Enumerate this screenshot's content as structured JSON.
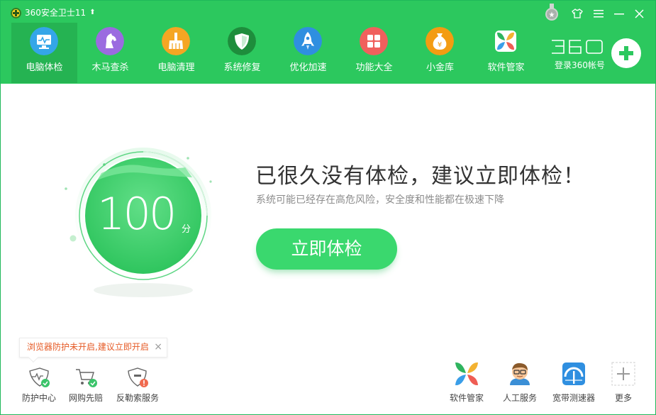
{
  "app": {
    "title": "360安全卫士11"
  },
  "tabs": [
    {
      "label": "电脑体检",
      "icon": "monitor-check-icon",
      "color": "#34a6e8"
    },
    {
      "label": "木马查杀",
      "icon": "horse-icon",
      "color": "#9b6be0"
    },
    {
      "label": "电脑清理",
      "icon": "broom-icon",
      "color": "#f5a623"
    },
    {
      "label": "系统修复",
      "icon": "shield-icon",
      "color": "#1e8d3c"
    },
    {
      "label": "优化加速",
      "icon": "rocket-icon",
      "color": "#2f8fe0"
    },
    {
      "label": "功能大全",
      "icon": "grid-icon",
      "color": "#f0605d"
    },
    {
      "label": "小金库",
      "icon": "money-bag-icon",
      "color": "#f39c12"
    },
    {
      "label": "软件管家",
      "icon": "software-manager-icon",
      "color": "#ffffff"
    }
  ],
  "login": {
    "brand": "360",
    "label": "登录360帐号"
  },
  "score": {
    "value": "100",
    "unit": "分"
  },
  "main": {
    "headline": "已很久没有体检，建议立即体检！",
    "subtitle": "系统可能已经存在高危风险，安全度和性能都在极速下降",
    "button": "立即体检"
  },
  "tooltip": {
    "text": "浏览器防护未开启,建议立即开启"
  },
  "bottom_left": [
    {
      "label": "防护中心",
      "icon": "protection-center-icon"
    },
    {
      "label": "网购先赔",
      "icon": "shopping-cart-icon"
    },
    {
      "label": "反勒索服务",
      "icon": "anti-ransom-icon"
    }
  ],
  "bottom_right": [
    {
      "label": "软件管家",
      "icon": "software-manager-icon"
    },
    {
      "label": "人工服务",
      "icon": "customer-service-icon"
    },
    {
      "label": "宽带测速器",
      "icon": "speed-test-icon"
    },
    {
      "label": "更多",
      "icon": "more-icon"
    }
  ],
  "colors": {
    "brand_green": "#2cc85e",
    "button_green": "#3ad86e",
    "warning": "#e65a25"
  }
}
